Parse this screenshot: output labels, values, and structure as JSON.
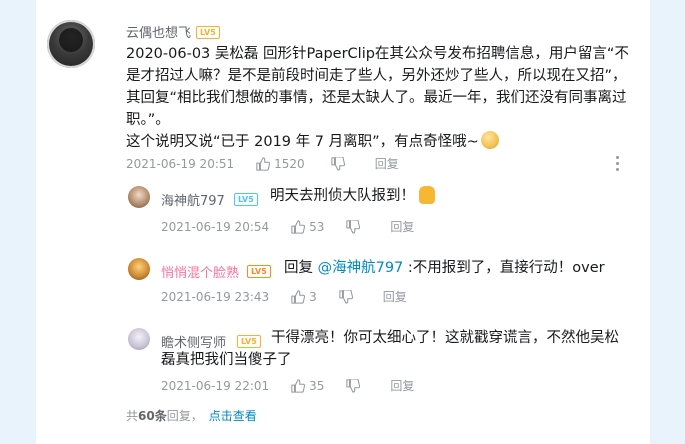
{
  "main_comment": {
    "username": "云偶也想飞",
    "level": "LV5",
    "text_parts": [
      "2020-06-03  吴松磊  回形针PaperClip在其公众号发布招聘信息，用户留言“不是才招过人嘛？是不是前段时间走了些人，另外还炒了些人，所以现在又招”，其回复“相比我们想做的事情，还是太缺人了。最近一年，我们还没有同事离过职。”。",
      "这个说明又说“已于 2019 年 7 月离职”，有点奇怪哦~"
    ],
    "emoji_icon": "doge-emoji-icon",
    "time": "2021-06-19 20:51",
    "likes": "1520",
    "reply_label": "回复"
  },
  "replies": [
    {
      "username": "海神航797",
      "level": "LV5",
      "text": "明天去刑侦大队报到！",
      "emoji_icon": "thumbs-up-emoji-icon",
      "time": "2021-06-19 20:54",
      "likes": "53",
      "reply_label": "回复"
    },
    {
      "username": "悄悄混个脸熟",
      "level": "LV5",
      "reply_prefix": "回复 ",
      "mention": "@海神航797",
      "text": " :不用报到了，直接行动！over",
      "time": "2021-06-19 23:43",
      "likes": "3",
      "reply_label": "回复"
    },
    {
      "username": "瞻术侧写师",
      "level": "LV5",
      "text": "干得漂亮！你可太细心了！这就戳穿谎言，不然他吴松磊真把我们当傻子了",
      "time": "2021-06-19 22:01",
      "likes": "35",
      "reply_label": "回复"
    }
  ],
  "footer": {
    "prefix": "共",
    "count": "60条",
    "suffix": "回复，",
    "link": "点击查看"
  },
  "colors": {
    "background": "#e8f3fb",
    "link": "#008ac5",
    "pink_name": "#fb7299",
    "meta": "#9499a0"
  }
}
